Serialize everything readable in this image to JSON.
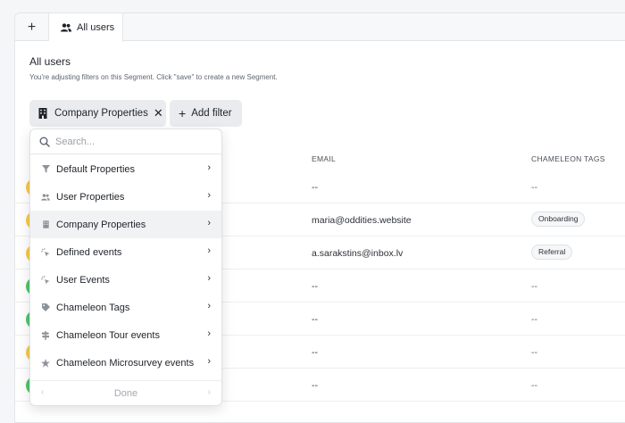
{
  "tabs": {
    "add_label": "+",
    "active_label": "All users"
  },
  "header": {
    "title": "All users",
    "subtitle": "You're adjusting filters on this Segment. Click \"save\" to create a new Segment."
  },
  "filters": {
    "chip_label": "Company Properties",
    "chip_remove": "✕",
    "add_plus": "+",
    "add_label": "Add filter"
  },
  "table": {
    "columns": {
      "email": "EMAIL",
      "tags": "CHAMELEON TAGS"
    },
    "rows": [
      {
        "email": "--",
        "tag": "--",
        "avatar_color": "#f5c94a"
      },
      {
        "email": "maria@oddities.website",
        "tag": "Onboarding",
        "avatar_color": "#f5c94a"
      },
      {
        "email": "a.sarakstins@inbox.lv",
        "tag": "Referral",
        "avatar_color": "#f5c94a"
      },
      {
        "email": "--",
        "tag": "--",
        "avatar_color": "#4fc46b"
      },
      {
        "email": "--",
        "tag": "--",
        "avatar_color": "#4fc46b"
      },
      {
        "email": "--",
        "tag": "--",
        "avatar_color": "#f5c94a"
      },
      {
        "email": "--",
        "tag": "--",
        "avatar_color": "#4fc46b"
      }
    ]
  },
  "dropdown": {
    "search_placeholder": "Search...",
    "items": [
      {
        "label": "Default Properties",
        "icon": "funnel-icon",
        "chevron": "›"
      },
      {
        "label": "User Properties",
        "icon": "users-icon",
        "chevron": "›"
      },
      {
        "label": "Company Properties",
        "icon": "building-icon",
        "chevron": "›"
      },
      {
        "label": "Defined events",
        "icon": "cursor-click-icon",
        "chevron": "›"
      },
      {
        "label": "User Events",
        "icon": "cursor-click-icon",
        "chevron": "›"
      },
      {
        "label": "Chameleon Tags",
        "icon": "tag-icon",
        "chevron": "›"
      },
      {
        "label": "Chameleon Tour events",
        "icon": "signpost-icon",
        "chevron": "›"
      },
      {
        "label": "Chameleon Microsurvey events",
        "icon": "star-icon",
        "chevron": "›"
      }
    ],
    "footer": {
      "prev": "‹",
      "done_label": "Done",
      "next": "›"
    }
  }
}
